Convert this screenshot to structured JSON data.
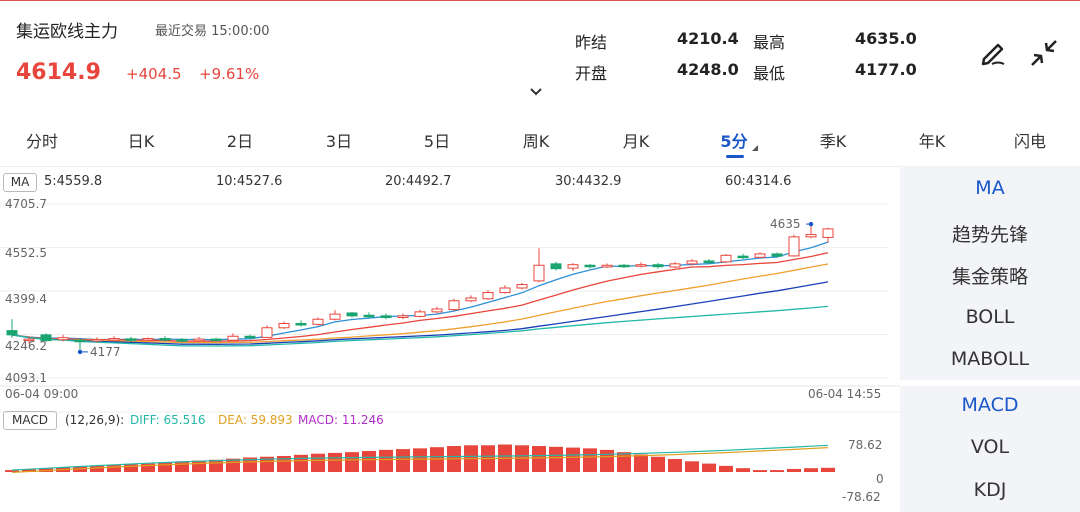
{
  "header": {
    "title": "集运欧线主力",
    "last_trade": "最近交易  15:00:00",
    "price": "4614.9",
    "change": "+404.5",
    "change_pct": "+9.61%"
  },
  "stats": [
    {
      "label": "昨结",
      "value": "4210.4"
    },
    {
      "label": "最高",
      "value": "4635.0"
    },
    {
      "label": "开盘",
      "value": "4248.0"
    },
    {
      "label": "最低",
      "value": "4177.0"
    }
  ],
  "tabs": [
    "分时",
    "日K",
    "2日",
    "3日",
    "5日",
    "周K",
    "月K",
    "5分",
    "季K",
    "年K",
    "闪电"
  ],
  "active_tab": "5分",
  "ma": {
    "label": "MA",
    "values": [
      {
        "text": "5:4559.8",
        "color": "#2e8fd6"
      },
      {
        "text": "10:4527.6",
        "color": "#e8453c"
      },
      {
        "text": "20:4492.7",
        "color": "#f0a030"
      },
      {
        "text": "30:4432.9",
        "color": "#1c3fb8"
      },
      {
        "text": "60:4314.6",
        "color": "#22b8a8"
      }
    ]
  },
  "axis": {
    "y_labels": [
      "4705.7",
      "4552.5",
      "4399.4",
      "4246.2",
      "4093.1"
    ],
    "x_start": "06-04 09:00",
    "x_end": "06-04 14:55",
    "high_label": "4635",
    "low_label": "4177"
  },
  "macd": {
    "label": "MACD",
    "params": "(12,26,9):",
    "diff": {
      "text": "DIFF: 65.516",
      "color": "#22b8a8"
    },
    "dea": {
      "text": "DEA: 59.893",
      "color": "#e0a020"
    },
    "macd": {
      "text": "MACD: 11.246",
      "color": "#b030c8"
    },
    "y_top": "78.62",
    "y_zero": "0",
    "y_bottom": "-78.62"
  },
  "panel": {
    "group1": [
      "MA",
      "趋势先锋",
      "集金策略",
      "BOLL",
      "MABOLL"
    ],
    "group2": [
      "MACD",
      "VOL",
      "KDJ"
    ]
  },
  "colors": {
    "up": "#e8453c",
    "down": "#1aa570",
    "accent": "#1a57c9"
  },
  "chart_data": {
    "type": "candlestick",
    "interval": "5分",
    "y_range": [
      4093.1,
      4705.7
    ],
    "candles": [
      {
        "o": 4260,
        "c": 4245,
        "h": 4300,
        "l": 4235
      },
      {
        "o": 4225,
        "c": 4230,
        "h": 4240,
        "l": 4215
      },
      {
        "o": 4245,
        "c": 4225,
        "h": 4250,
        "l": 4220
      },
      {
        "o": 4228,
        "c": 4235,
        "h": 4245,
        "l": 4222
      },
      {
        "o": 4226,
        "c": 4222,
        "h": 4232,
        "l": 4185
      },
      {
        "o": 4225,
        "c": 4229,
        "h": 4236,
        "l": 4218
      },
      {
        "o": 4230,
        "c": 4232,
        "h": 4240,
        "l": 4225
      },
      {
        "o": 4231,
        "c": 4229,
        "h": 4238,
        "l": 4222
      },
      {
        "o": 4230,
        "c": 4232,
        "h": 4236,
        "l": 4225
      },
      {
        "o": 4232,
        "c": 4228,
        "h": 4240,
        "l": 4222
      },
      {
        "o": 4228,
        "c": 4224,
        "h": 4234,
        "l": 4218
      },
      {
        "o": 4224,
        "c": 4230,
        "h": 4238,
        "l": 4220
      },
      {
        "o": 4230,
        "c": 4226,
        "h": 4235,
        "l": 4222
      },
      {
        "o": 4226,
        "c": 4240,
        "h": 4250,
        "l": 4222
      },
      {
        "o": 4240,
        "c": 4236,
        "h": 4246,
        "l": 4230
      },
      {
        "o": 4236,
        "c": 4270,
        "h": 4278,
        "l": 4234
      },
      {
        "o": 4270,
        "c": 4285,
        "h": 4292,
        "l": 4266
      },
      {
        "o": 4285,
        "c": 4280,
        "h": 4296,
        "l": 4274
      },
      {
        "o": 4282,
        "c": 4300,
        "h": 4306,
        "l": 4278
      },
      {
        "o": 4300,
        "c": 4318,
        "h": 4332,
        "l": 4296
      },
      {
        "o": 4322,
        "c": 4312,
        "h": 4326,
        "l": 4306
      },
      {
        "o": 4314,
        "c": 4310,
        "h": 4324,
        "l": 4304
      },
      {
        "o": 4312,
        "c": 4306,
        "h": 4320,
        "l": 4300
      },
      {
        "o": 4306,
        "c": 4312,
        "h": 4320,
        "l": 4300
      },
      {
        "o": 4310,
        "c": 4326,
        "h": 4334,
        "l": 4306
      },
      {
        "o": 4326,
        "c": 4336,
        "h": 4344,
        "l": 4320
      },
      {
        "o": 4334,
        "c": 4365,
        "h": 4372,
        "l": 4330
      },
      {
        "o": 4365,
        "c": 4375,
        "h": 4384,
        "l": 4360
      },
      {
        "o": 4372,
        "c": 4394,
        "h": 4402,
        "l": 4368
      },
      {
        "o": 4394,
        "c": 4410,
        "h": 4420,
        "l": 4390
      },
      {
        "o": 4410,
        "c": 4422,
        "h": 4428,
        "l": 4405
      },
      {
        "o": 4435,
        "c": 4490,
        "h": 4550,
        "l": 4430
      },
      {
        "o": 4495,
        "c": 4478,
        "h": 4502,
        "l": 4472
      },
      {
        "o": 4480,
        "c": 4492,
        "h": 4498,
        "l": 4470
      },
      {
        "o": 4490,
        "c": 4485,
        "h": 4495,
        "l": 4478
      },
      {
        "o": 4484,
        "c": 4490,
        "h": 4496,
        "l": 4480
      },
      {
        "o": 4490,
        "c": 4487,
        "h": 4495,
        "l": 4480
      },
      {
        "o": 4487,
        "c": 4492,
        "h": 4500,
        "l": 4482
      },
      {
        "o": 4492,
        "c": 4485,
        "h": 4498,
        "l": 4478
      },
      {
        "o": 4484,
        "c": 4495,
        "h": 4502,
        "l": 4480
      },
      {
        "o": 4495,
        "c": 4505,
        "h": 4512,
        "l": 4490
      },
      {
        "o": 4505,
        "c": 4500,
        "h": 4512,
        "l": 4494
      },
      {
        "o": 4502,
        "c": 4525,
        "h": 4530,
        "l": 4498
      },
      {
        "o": 4522,
        "c": 4518,
        "h": 4530,
        "l": 4512
      },
      {
        "o": 4518,
        "c": 4530,
        "h": 4536,
        "l": 4514
      },
      {
        "o": 4530,
        "c": 4522,
        "h": 4535,
        "l": 4518
      },
      {
        "o": 4523,
        "c": 4590,
        "h": 4598,
        "l": 4520
      },
      {
        "o": 4590,
        "c": 4598,
        "h": 4635,
        "l": 4585
      },
      {
        "o": 4588,
        "c": 4618,
        "h": 4622,
        "l": 4570
      }
    ],
    "ma_lines": {
      "MA5": {
        "value": 4559.8,
        "color": "#2e8fd6"
      },
      "MA10": {
        "value": 4527.6,
        "color": "#e8453c"
      },
      "MA20": {
        "value": 4492.7,
        "color": "#f0a030"
      },
      "MA30": {
        "value": 4432.9,
        "color": "#1c3fb8"
      },
      "MA60": {
        "value": 4314.6,
        "color": "#22b8a8"
      }
    },
    "macd_range": [
      -78.62,
      78.62
    ],
    "macd_hist": [
      5,
      8,
      10,
      12,
      14,
      16,
      18,
      20,
      22,
      25,
      28,
      30,
      32,
      35,
      38,
      40,
      42,
      45,
      48,
      50,
      52,
      55,
      58,
      60,
      62,
      65,
      68,
      70,
      70,
      72,
      70,
      68,
      66,
      64,
      62,
      58,
      52,
      46,
      40,
      34,
      28,
      22,
      16,
      10,
      5,
      5,
      8,
      10,
      11
    ]
  }
}
